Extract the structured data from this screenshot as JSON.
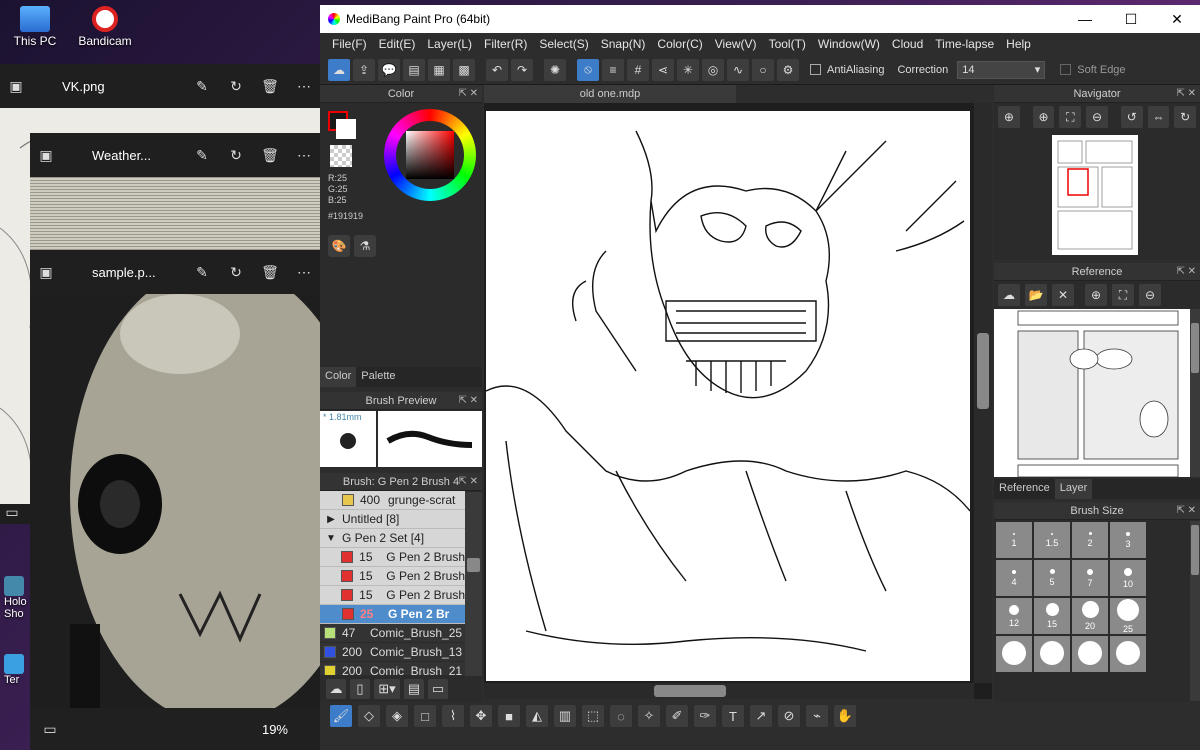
{
  "desktop": {
    "icons": [
      {
        "label": "This PC",
        "icon": "computer-icon"
      },
      {
        "label": "Bandicam",
        "icon": "record-icon"
      },
      {
        "label": "Holo Sho",
        "icon": "app-icon"
      },
      {
        "label": "Ter",
        "icon": "app-icon"
      }
    ]
  },
  "photo_windows": [
    {
      "title": "VK.png"
    },
    {
      "title": "Weather..."
    },
    {
      "title": "sample.p...",
      "zoom": "19%"
    }
  ],
  "medibang": {
    "title": "MediBang Paint Pro (64bit)",
    "menu": [
      "File(F)",
      "Edit(E)",
      "Layer(L)",
      "Filter(R)",
      "Select(S)",
      "Snap(N)",
      "Color(C)",
      "View(V)",
      "Tool(T)",
      "Window(W)",
      "Cloud",
      "Time-lapse",
      "Help"
    ],
    "toolbar": {
      "antialiasing": "AntiAliasing",
      "correction_label": "Correction",
      "correction_value": "14",
      "soft_edge": "Soft Edge"
    },
    "document_tab": "old one.mdp",
    "color_panel": {
      "title": "Color",
      "r": "R:25",
      "g": "G:25",
      "b": "B:25",
      "hex": "#191919",
      "tabs": [
        "Color",
        "Palette"
      ]
    },
    "brush_preview": {
      "title": "Brush Preview",
      "size": "1.81mm"
    },
    "brush_panel": {
      "title": "Brush: G Pen 2 Brush 4",
      "rows": [
        {
          "size": "400",
          "name": "grunge-scrat",
          "color": "#e8c84a",
          "style": "light"
        },
        {
          "size": "",
          "name": "Untitled [8]",
          "color": "",
          "style": "group",
          "arrow": "▶"
        },
        {
          "size": "",
          "name": "G Pen 2 Set [4]",
          "color": "",
          "style": "group",
          "arrow": "▼"
        },
        {
          "size": "15",
          "name": "G Pen 2 Brush",
          "color": "#e03030",
          "style": "light"
        },
        {
          "size": "15",
          "name": "G Pen 2 Brush",
          "color": "#e03030",
          "style": "light"
        },
        {
          "size": "15",
          "name": "G Pen 2 Brush",
          "color": "#e03030",
          "style": "light"
        },
        {
          "size": "25",
          "name": "G Pen 2 Br",
          "color": "#e03030",
          "style": "sel"
        },
        {
          "size": "47",
          "name": "Comic_Brush_25",
          "color": "#b8e07a",
          "style": "dark"
        },
        {
          "size": "200",
          "name": "Comic_Brush_13",
          "color": "#3050e0",
          "style": "dark"
        },
        {
          "size": "200",
          "name": "Comic_Brush_21",
          "color": "#e0d030",
          "style": "dark"
        }
      ]
    },
    "navigator": {
      "title": "Navigator"
    },
    "reference": {
      "title": "Reference",
      "tabs": [
        "Reference",
        "Layer"
      ]
    },
    "brush_size": {
      "title": "Brush Size",
      "sizes": [
        "1",
        "1.5",
        "2",
        "3",
        "4",
        "5",
        "7",
        "10",
        "12",
        "15",
        "20",
        "25",
        "",
        "",
        "",
        ""
      ]
    }
  }
}
